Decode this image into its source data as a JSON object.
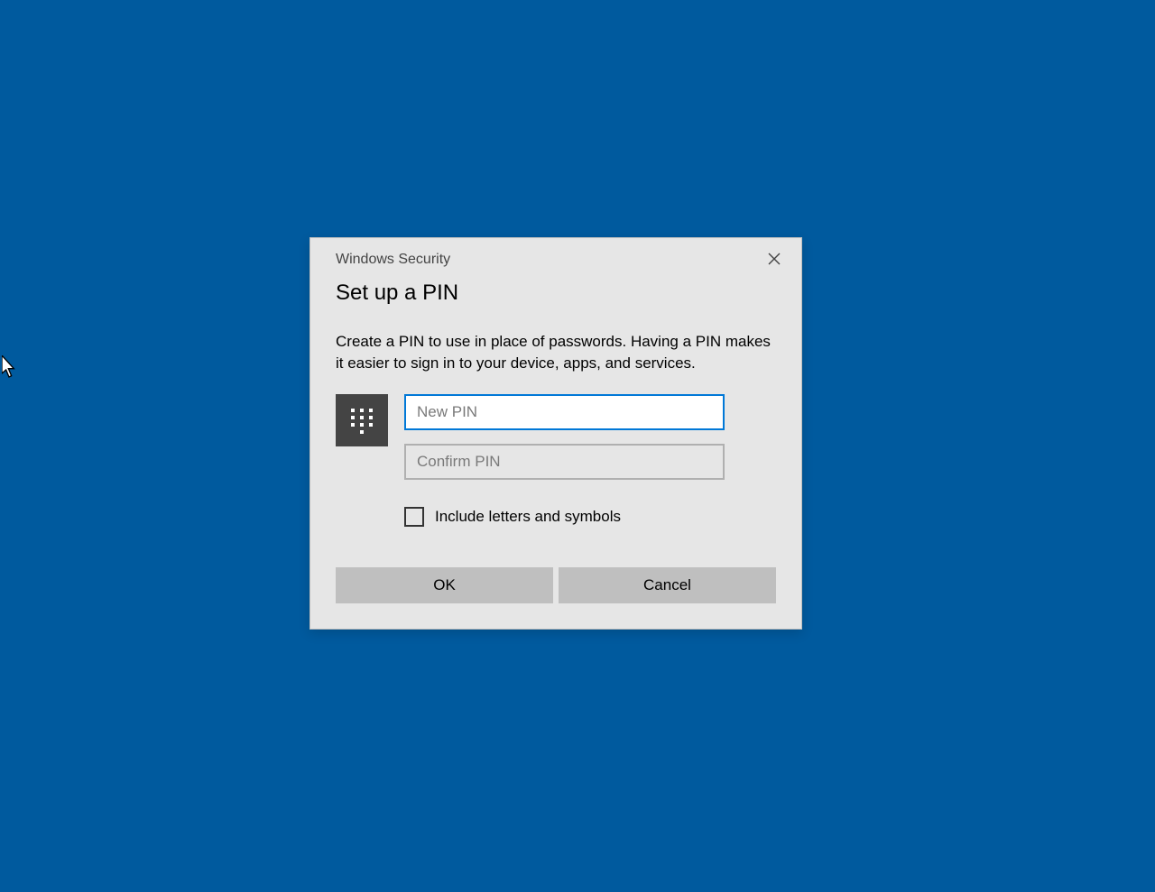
{
  "dialog": {
    "app_title": "Windows Security",
    "title": "Set up a PIN",
    "description": "Create a PIN to use in place of passwords. Having a PIN makes it easier to sign in to your device, apps, and services.",
    "new_pin_placeholder": "New PIN",
    "new_pin_value": "",
    "confirm_pin_placeholder": "Confirm PIN",
    "confirm_pin_value": "",
    "include_letters_label": "Include letters and symbols",
    "include_letters_checked": false,
    "ok_label": "OK",
    "cancel_label": "Cancel"
  }
}
